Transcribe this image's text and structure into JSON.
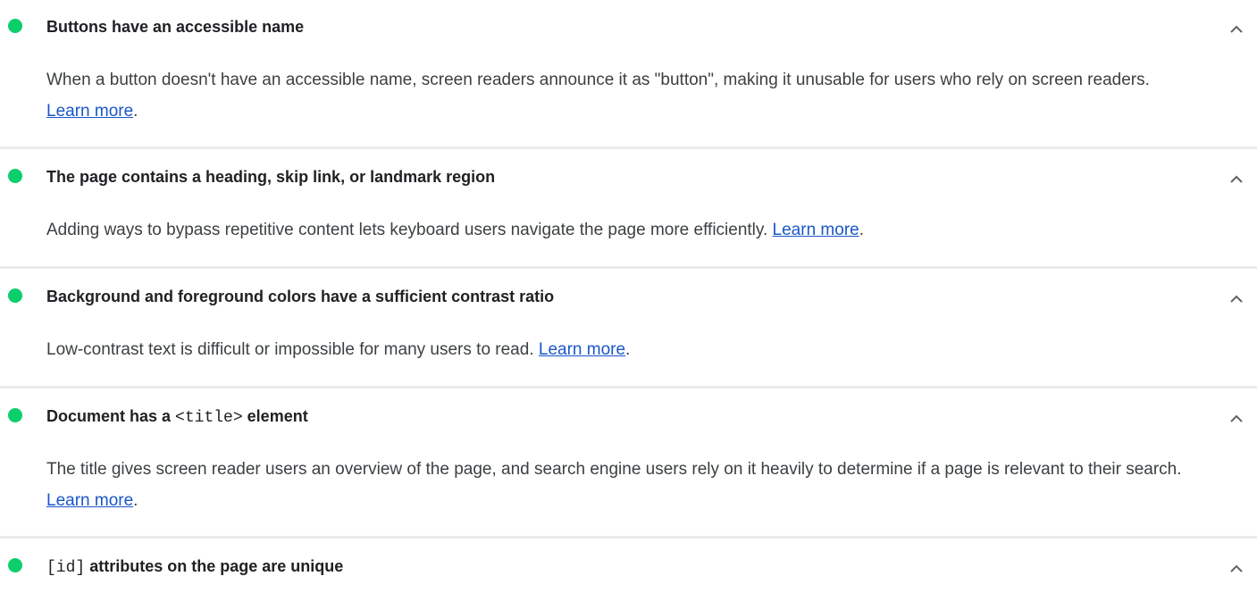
{
  "colors": {
    "pass": "#0cce6b",
    "link": "#1a56c9"
  },
  "audits": [
    {
      "title_parts": [
        "Buttons have an accessible name"
      ],
      "description": "When a button doesn't have an accessible name, screen readers announce it as \"button\", making it unusable for users who rely on screen readers. ",
      "link": "Learn more",
      "after": ".",
      "icon": "chevron-up-icon"
    },
    {
      "title_parts": [
        "The page contains a heading, skip link, or landmark region"
      ],
      "description": "Adding ways to bypass repetitive content lets keyboard users navigate the page more efficiently. ",
      "link": "Learn more",
      "after": ".",
      "icon": "chevron-up-icon"
    },
    {
      "title_parts": [
        "Background and foreground colors have a sufficient contrast ratio"
      ],
      "description": "Low-contrast text is difficult or impossible for many users to read. ",
      "link": "Learn more",
      "after": ".",
      "icon": "chevron-up-icon"
    },
    {
      "title_parts": [
        "Document has a ",
        "<title>",
        " element"
      ],
      "description": "The title gives screen reader users an overview of the page, and search engine users rely on it heavily to determine if a page is relevant to their search. ",
      "link": "Learn more",
      "after": ".",
      "icon": "chevron-up-icon"
    },
    {
      "title_parts": [
        "",
        "[id]",
        " attributes on the page are unique"
      ],
      "icon": "chevron-up-icon"
    }
  ]
}
